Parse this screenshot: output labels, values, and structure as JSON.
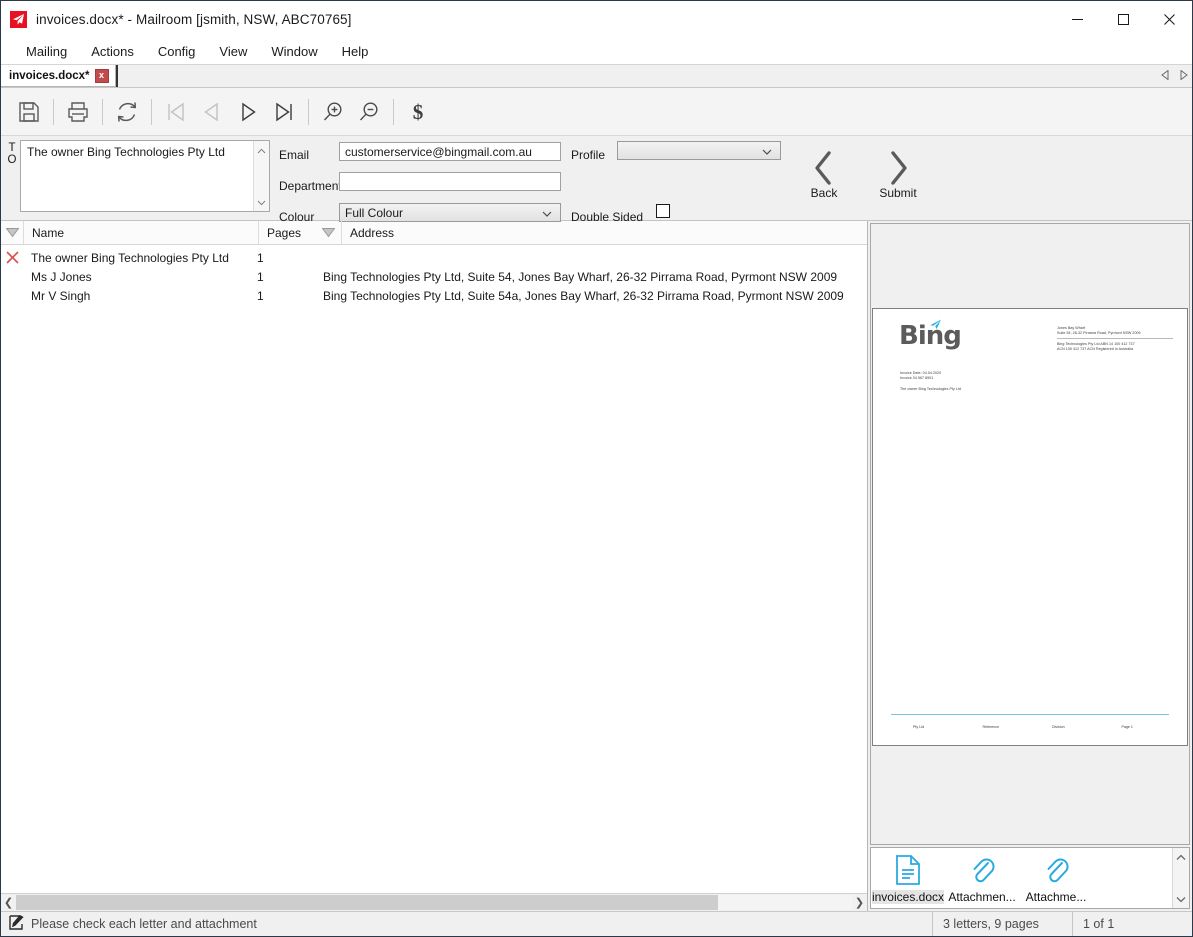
{
  "window": {
    "title": "invoices.docx* - Mailroom [jsmith, NSW, ABC70765]",
    "app_icon": "paper-plane-icon",
    "minimize": "—",
    "maximize": "□",
    "close": "✕"
  },
  "menu": {
    "items": [
      {
        "label": "Mailing"
      },
      {
        "label": "Actions"
      },
      {
        "label": "Config"
      },
      {
        "label": "View"
      },
      {
        "label": "Window"
      },
      {
        "label": "Help"
      }
    ]
  },
  "tabs": {
    "items": [
      {
        "label": "invoices.docx*",
        "close": "x"
      }
    ],
    "nav_prev": "◁",
    "nav_next": "▷"
  },
  "toolbar": {
    "buttons": [
      {
        "name": "save-icon",
        "title": "Save"
      },
      {
        "name": "print-icon",
        "title": "Print"
      },
      {
        "name": "refresh-icon",
        "title": "Refresh"
      },
      {
        "name": "first-page-icon",
        "title": "First"
      },
      {
        "name": "prev-page-icon",
        "title": "Previous"
      },
      {
        "name": "next-page-icon",
        "title": "Next"
      },
      {
        "name": "last-page-icon",
        "title": "Last"
      },
      {
        "name": "zoom-in-icon",
        "title": "Zoom In"
      },
      {
        "name": "zoom-out-icon",
        "title": "Zoom Out"
      },
      {
        "name": "cost-icon",
        "title": "Cost"
      }
    ]
  },
  "form": {
    "to_label": "TO",
    "to_value": "The owner Bing Technologies Pty Ltd",
    "email_label": "Email",
    "email_value": "customerservice@bingmail.com.au",
    "department_label": "Department",
    "department_value": "",
    "colour_label": "Colour",
    "colour_value": "Full Colour",
    "profile_label": "Profile",
    "profile_value": "",
    "double_sided_label": "Double Sided",
    "double_sided_checked": false,
    "back_label": "Back",
    "submit_label": "Submit"
  },
  "grid": {
    "columns": [
      "Name",
      "Pages",
      "Address"
    ],
    "rows": [
      {
        "flag": "error-x-icon",
        "name": "The owner Bing Technologies Pty Ltd",
        "pages": "1",
        "address": ""
      },
      {
        "flag": "",
        "name": "Ms J Jones",
        "pages": "1",
        "address": "Bing Technologies Pty Ltd, Suite 54, Jones Bay Wharf, 26-32 Pirrama Road, Pyrmont NSW 2009"
      },
      {
        "flag": "",
        "name": "Mr V Singh",
        "pages": "1",
        "address": "Bing Technologies Pty Ltd, Suite 54a, Jones Bay Wharf, 26-32 Pirrama Road, Pyrmont NSW 2009"
      }
    ]
  },
  "preview": {
    "logo_text": "Bing",
    "invoice_date": "Invoice Date: 04.04.2020",
    "invoice_number": "Invoice 34 567 8901",
    "recipient": "The owner Bing Technologies Pty Ltd",
    "header_block_1": "Jones Bay Wharf",
    "header_block_2": "Suite 54, 26-32 Pirrama Road, Pyrmont NSW 2009",
    "header_block_3": "Bing Technologies Pty Ltd    ABN 14 100 412 737",
    "header_block_4": "ACN 100 412 737                ACN Registered in Australia",
    "footer_col_1": "Pty Ltd",
    "footer_col_2": "Reference",
    "footer_col_3": "Division",
    "footer_col_4": "Page 1"
  },
  "attachments": {
    "items": [
      {
        "name": "invoices.docx",
        "icon": "document-icon",
        "selected": true
      },
      {
        "name": "Attachmen...",
        "icon": "paperclip-icon",
        "selected": false
      },
      {
        "name": "Attachme...",
        "icon": "paperclip-icon",
        "selected": false
      }
    ],
    "scroll_up": "⌃",
    "scroll_down": "⌄"
  },
  "statusbar": {
    "message": "Please check each letter and attachment",
    "letters_pages": "3 letters, 9 pages",
    "page_of": "1 of 1"
  },
  "colors": {
    "accent_red": "#e81123",
    "attachment_blue": "#29abe2",
    "error_red": "#d9534f",
    "logo_gray": "#5b5b5b",
    "logo_blue": "#29abe2"
  }
}
